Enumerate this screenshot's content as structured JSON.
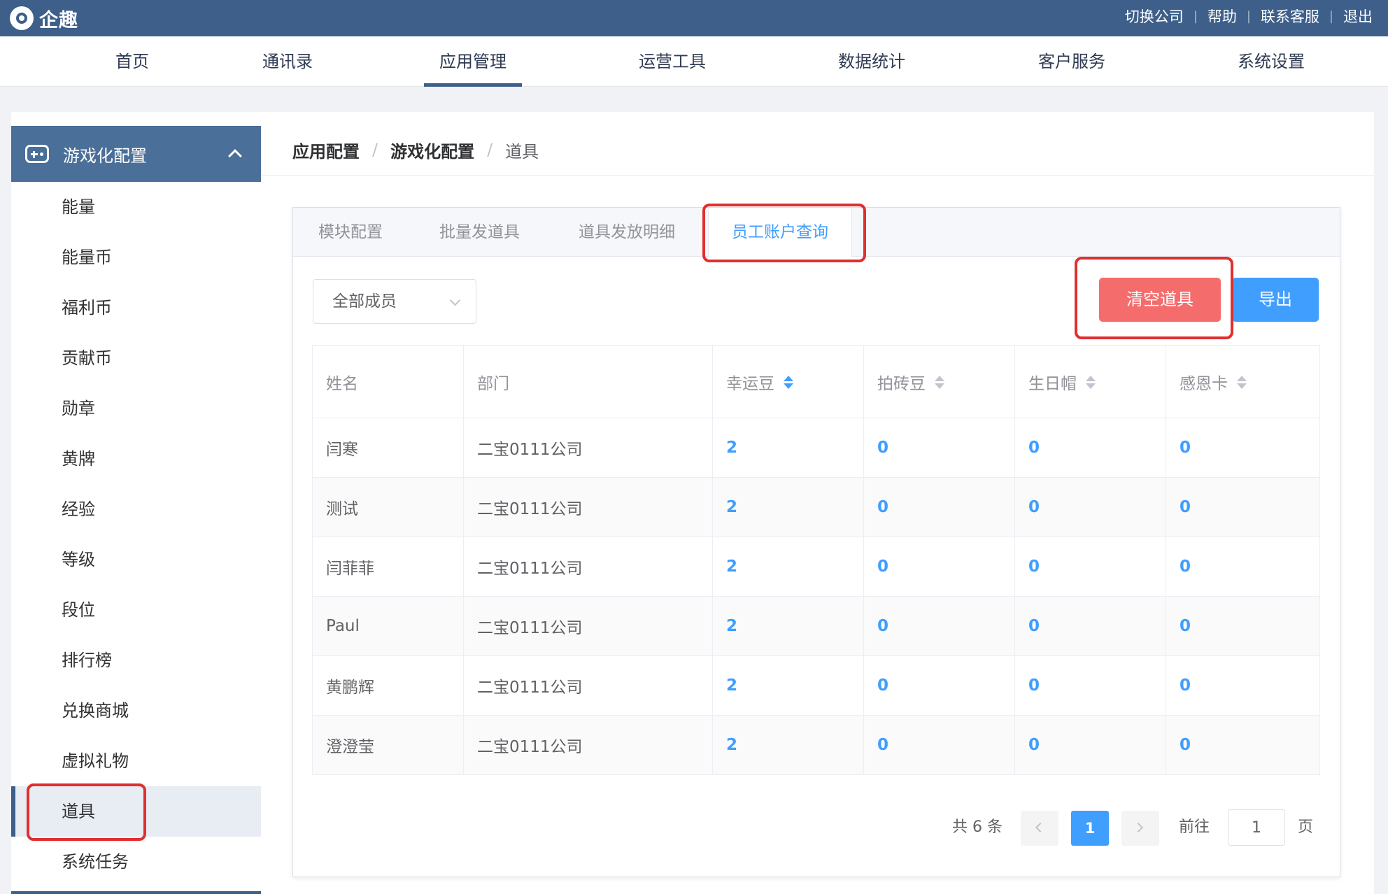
{
  "app": {
    "brand": "企趣"
  },
  "top_links": [
    "切换公司",
    "帮助",
    "联系客服",
    "退出"
  ],
  "nav": [
    "首页",
    "通讯录",
    "应用管理",
    "运营工具",
    "数据统计",
    "客户服务",
    "系统设置"
  ],
  "nav_active": "应用管理",
  "sidebar": {
    "section_title": "游戏化配置",
    "items": [
      "能量",
      "能量币",
      "福利币",
      "贡献币",
      "勋章",
      "黄牌",
      "经验",
      "等级",
      "段位",
      "排行榜",
      "兑换商城",
      "虚拟礼物",
      "道具",
      "系统任务"
    ],
    "active": "道具"
  },
  "breadcrumb": [
    "应用配置",
    "游戏化配置",
    "道具"
  ],
  "tabs": [
    "模块配置",
    "批量发道具",
    "道具发放明细",
    "员工账户查询"
  ],
  "active_tab": "员工账户查询",
  "filter": {
    "member_select": "全部成员"
  },
  "buttons": {
    "clear": "清空道具",
    "export": "导出"
  },
  "table": {
    "columns": [
      "姓名",
      "部门",
      "幸运豆",
      "拍砖豆",
      "生日帽",
      "感恩卡"
    ],
    "rows": [
      [
        "闫寒",
        "二宝0111公司",
        "2",
        "0",
        "0",
        "0"
      ],
      [
        "测试",
        "二宝0111公司",
        "2",
        "0",
        "0",
        "0"
      ],
      [
        "闫菲菲",
        "二宝0111公司",
        "2",
        "0",
        "0",
        "0"
      ],
      [
        "Paul",
        "二宝0111公司",
        "2",
        "0",
        "0",
        "0"
      ],
      [
        "黄鹏辉",
        "二宝0111公司",
        "2",
        "0",
        "0",
        "0"
      ],
      [
        "澄澄莹",
        "二宝0111公司",
        "2",
        "0",
        "0",
        "0"
      ]
    ]
  },
  "pagination": {
    "total": "共 6 条",
    "current": "1",
    "goto_label": "前往",
    "goto_value": "1",
    "goto_unit": "页"
  },
  "colors": {
    "header": "#3d5f8a",
    "sidebar_head": "#4a6f99",
    "primary": "#409eff",
    "danger": "#f56c6c",
    "highlight": "#e02f2f"
  }
}
